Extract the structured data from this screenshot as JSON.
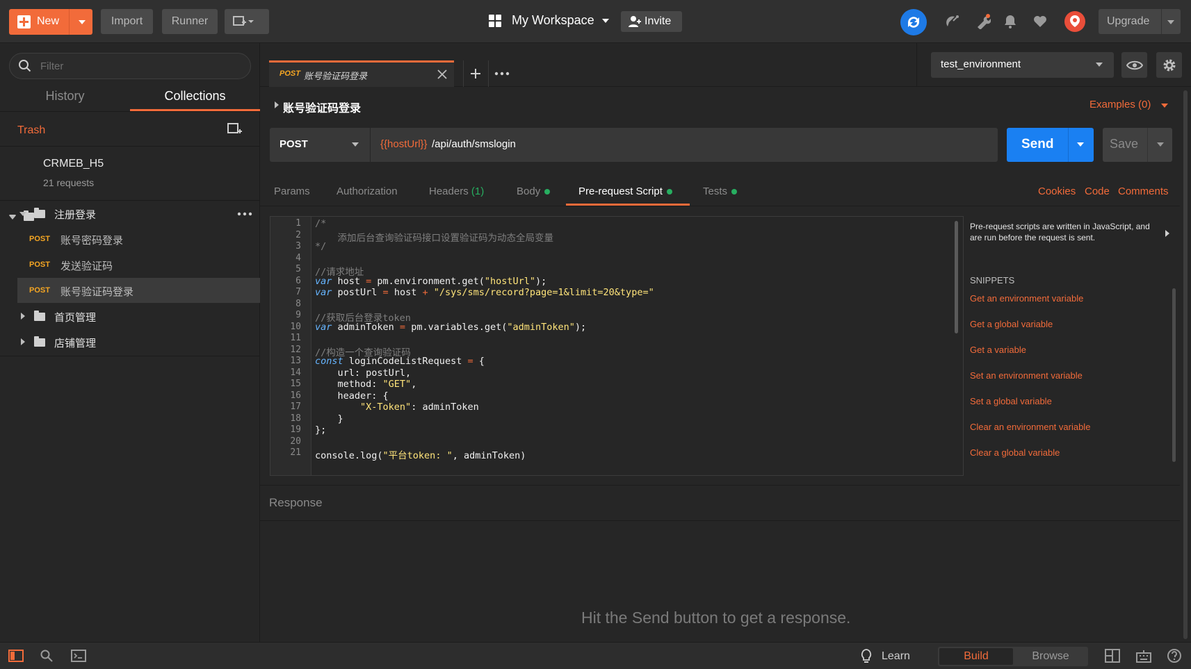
{
  "topbar": {
    "new_label": "New",
    "import_label": "Import",
    "runner_label": "Runner",
    "workspace_label": "My Workspace",
    "invite_label": "Invite",
    "upgrade_label": "Upgrade"
  },
  "sidebar": {
    "filter_placeholder": "Filter",
    "tabs": [
      {
        "label": "History"
      },
      {
        "label": "Collections"
      }
    ],
    "trash_label": "Trash",
    "collection": {
      "name": "CRMEB_H5",
      "count": "21 requests"
    },
    "folders": [
      {
        "name": "注册登录",
        "expanded": true
      },
      {
        "name": "首页管理",
        "expanded": false
      },
      {
        "name": "店铺管理",
        "expanded": false
      }
    ],
    "requests": [
      {
        "method": "POST",
        "name": "账号密码登录"
      },
      {
        "method": "POST",
        "name": "发送验证码"
      },
      {
        "method": "POST",
        "name": "账号验证码登录",
        "selected": true
      }
    ]
  },
  "request_tab": {
    "method": "POST",
    "name": "账号验证码登录"
  },
  "environment": {
    "selected": "test_environment"
  },
  "request": {
    "title": "账号验证码登录",
    "examples_label": "Examples (0)",
    "method": "POST",
    "url_var": "{{hostUrl}}",
    "url_path": "/api/auth/smslogin",
    "send_label": "Send",
    "save_label": "Save"
  },
  "request_tabs": [
    {
      "label": "Params"
    },
    {
      "label": "Authorization"
    },
    {
      "label": "Headers",
      "count": "(1)"
    },
    {
      "label": "Body"
    },
    {
      "label": "Pre-request Script"
    },
    {
      "label": "Tests"
    }
  ],
  "right_links": {
    "cookies": "Cookies",
    "code": "Code",
    "comments": "Comments"
  },
  "code_lines": [
    "/*",
    "    添加后台查询验证码接口设置验证码为动态全局变量",
    "*/",
    "",
    "//请求地址",
    "var host = pm.environment.get(\"hostUrl\");",
    "var postUrl = host + \"/sys/sms/record?page=1&limit=20&type=\"",
    "",
    "//获取后台登录token",
    "var adminToken = pm.variables.get(\"adminToken\");",
    "",
    "//构造一个查询验证码",
    "const loginCodeListRequest = {",
    "    url: postUrl,",
    "    method: \"GET\",",
    "    header: {",
    "        \"X-Token\": adminToken",
    "    }",
    "};",
    "",
    "console.log(\"平台token: \", adminToken)"
  ],
  "snippets": {
    "description": "Pre-request scripts are written in JavaScript, and are run before the request is sent.",
    "heading": "SNIPPETS",
    "items": [
      "Get an environment variable",
      "Get a global variable",
      "Get a variable",
      "Set an environment variable",
      "Set a global variable",
      "Clear an environment variable",
      "Clear a global variable"
    ]
  },
  "response": {
    "label": "Response",
    "hint": "Hit the Send button to get a response."
  },
  "statusbar": {
    "learn": "Learn",
    "build": "Build",
    "browse": "Browse"
  },
  "colors": {
    "accent": "#f26b3a",
    "send": "#1a80f2",
    "post": "#f5a623",
    "dot": "#27ae60"
  }
}
